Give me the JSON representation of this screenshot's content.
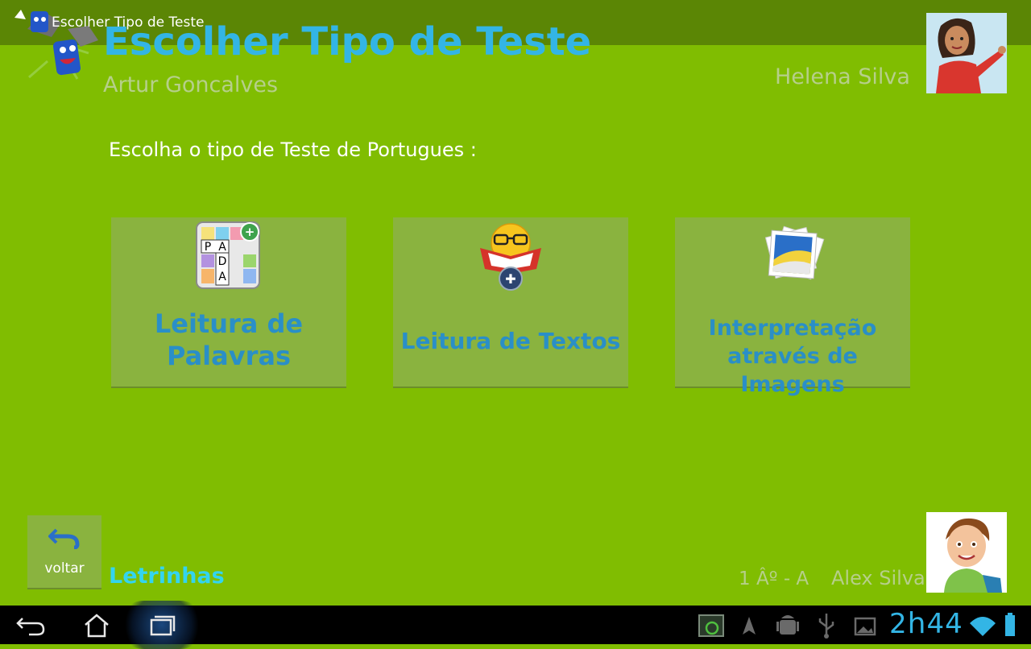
{
  "titlebar": {
    "text": "Escolher Tipo de Teste"
  },
  "header": {
    "title": "Escolher Tipo de Teste",
    "student_name": "Artur Goncalves",
    "teacher_name": "Helena Silva"
  },
  "prompt": "Escolha o tipo de Teste de Portugues :",
  "cards": [
    {
      "label_line1": "Leitura de",
      "label_line2": "Palavras",
      "icon": "word-puzzle-icon"
    },
    {
      "label": "Leitura de Textos",
      "icon": "reading-smiley-icon"
    },
    {
      "label_line1": "Interpretação",
      "label_line2": "através de Imagens",
      "icon": "photos-stack-icon"
    }
  ],
  "footer": {
    "back_label": "voltar",
    "app_name": "Letrinhas",
    "class_label": "1 Âº - A",
    "child_name": "Alex Silva"
  },
  "navbar": {
    "clock_hours": "2",
    "clock_h": "h",
    "clock_minutes": "44",
    "icons": [
      "back-icon",
      "home-icon",
      "recent-apps-icon",
      "screenshot-icon",
      "navigation-icon",
      "android-debug-icon",
      "usb-icon",
      "image-icon",
      "wifi-icon",
      "battery-icon"
    ]
  },
  "colors": {
    "background": "#80bd01",
    "card": "#8ab33f",
    "accent_blue": "#33b5e5",
    "card_text": "#2a8fc7"
  }
}
